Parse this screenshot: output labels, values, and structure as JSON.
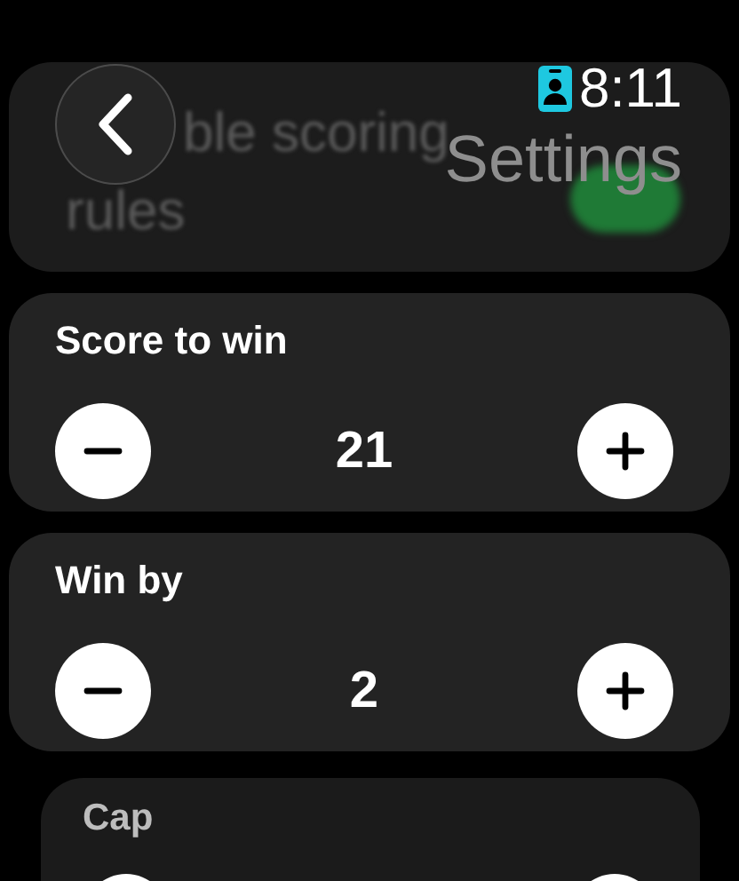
{
  "header": {
    "title": "Settings",
    "time": "8:11"
  },
  "toggle_row": {
    "label_lines": [
      "ble scoring",
      "rules"
    ],
    "on": true
  },
  "steppers": [
    {
      "label": "Score to win",
      "value": "21"
    },
    {
      "label": "Win by",
      "value": "2"
    },
    {
      "label": "Cap"
    }
  ]
}
